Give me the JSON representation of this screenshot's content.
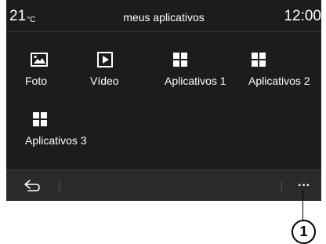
{
  "status_bar": {
    "temperature": "21",
    "temperature_unit": "°C",
    "title": "meus aplicativos",
    "clock": "12:00"
  },
  "apps": [
    {
      "label": "Foto",
      "icon": "photo-icon"
    },
    {
      "label": "Vídeo",
      "icon": "video-play-icon"
    },
    {
      "label": "Aplicativos 1",
      "icon": "apps-grid-icon"
    },
    {
      "label": "Aplicativos 2",
      "icon": "apps-grid-icon"
    },
    {
      "label": "Aplicativos 3",
      "icon": "apps-grid-icon"
    }
  ],
  "bottom_bar": {
    "back_icon": "back-arrow-icon",
    "more_label": "···",
    "more_icon": "more-options-icon"
  },
  "callout": {
    "label": "1"
  },
  "colors": {
    "screen_background": "#1c1c1c",
    "bottom_bar_background": "#2a2a2a",
    "text": "#ffffff"
  }
}
